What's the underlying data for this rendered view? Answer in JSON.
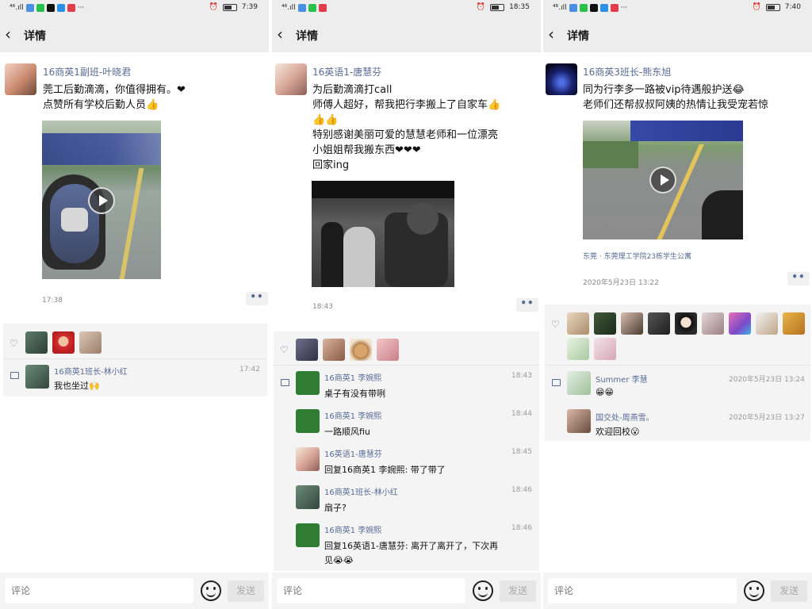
{
  "panels": [
    {
      "status": {
        "signal": "⁴⁶.ıll",
        "time": "7:39"
      },
      "nav": {
        "title": "详情"
      },
      "post": {
        "author": "16商英1副班-叶晓君",
        "lines": [
          "莞工后勤滴滴，你值得拥有。❤",
          "点赞所有学校后勤人员👍"
        ],
        "video": true,
        "location": "",
        "time": "17:38"
      },
      "likes": [
        "like-a",
        "like-b",
        "like-c"
      ],
      "comments": [
        {
          "name": "16商英1班长-林小红",
          "time": "17:42",
          "text": "我也坐过🙌"
        }
      ],
      "input": {
        "placeholder": "评论"
      },
      "send_label": "发送"
    },
    {
      "status": {
        "signal": "⁴⁶.ıll",
        "time": "18:35"
      },
      "nav": {
        "title": "详情"
      },
      "post": {
        "author": "16英语1-唐慧芬",
        "lines": [
          "为后勤滴滴打call",
          "师傅人超好，帮我把行李搬上了自家车👍",
          "👍👍",
          "特别感谢美丽可爱的慧慧老师和一位漂亮",
          "小姐姐帮我搬东西❤❤❤",
          "回家ing"
        ],
        "video": false,
        "location": "",
        "time": "18:43"
      },
      "likes": [
        "like-a",
        "like-b",
        "like-c",
        "like-d"
      ],
      "comments": [
        {
          "name": "16商英1 李婉熙",
          "time": "18:43",
          "text": "桌子有没有带咧"
        },
        {
          "name": "16商英1 李婉熙",
          "time": "18:44",
          "text": "一路顺风fiu"
        },
        {
          "name": "16英语1-唐慧芬",
          "time": "18:45",
          "text": "回复16商英1 李婉熙: 带了带了"
        },
        {
          "name": "16商英1班长-林小红",
          "time": "18:46",
          "text": "扇子?"
        },
        {
          "name": "16商英1 李婉熙",
          "time": "18:46",
          "text": "回复16英语1-唐慧芬: 离开了离开了，下次再"
        },
        {
          "name": "",
          "time": "",
          "text": "见😭😭"
        }
      ],
      "input": {
        "placeholder": "评论"
      },
      "send_label": "发送"
    },
    {
      "status": {
        "signal": "⁴⁶.ıll",
        "time": "7:40"
      },
      "nav": {
        "title": "详情"
      },
      "post": {
        "author": "16商英3班长-熊东旭",
        "lines": [
          "同为行李多一路被vip待遇般护送😂",
          "老师们还帮叔叔阿姨的热情让我受宠若惊"
        ],
        "video": true,
        "location": "东莞 · 东莞理工学院23栋学生公寓",
        "time": "2020年5月23日 13:22"
      },
      "likes": [
        "l1",
        "l2",
        "l3",
        "l4",
        "l5",
        "l6",
        "l7",
        "l8",
        "l9",
        "l10",
        "l11"
      ],
      "comments": [
        {
          "name": "Summer 李慧",
          "time": "2020年5月23日 13:24",
          "text": "😁😁"
        },
        {
          "name": "国交处-周燕雪。",
          "time": "2020年5月23日 13:27",
          "text": "欢迎回校😮"
        }
      ],
      "input": {
        "placeholder": "评论"
      },
      "send_label": "发送"
    }
  ],
  "colors": {
    "link": "#576b95",
    "bar": "#ededed",
    "heart": "#576b95"
  },
  "icons": {
    "back": "chevron-left-icon",
    "like": "heart-icon",
    "comment": "comment-icon",
    "emoji": "smiley-icon",
    "play": "play-icon"
  }
}
